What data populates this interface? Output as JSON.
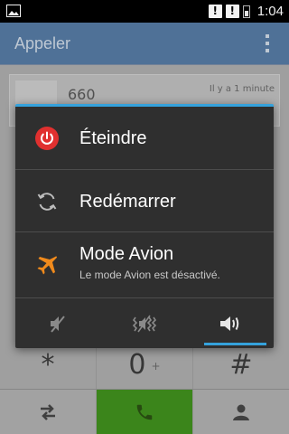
{
  "status_bar": {
    "time": "1:04",
    "alert_1": "!",
    "alert_2": "!",
    "left_icon": "image-icon"
  },
  "action_bar": {
    "title": "Appeler",
    "overflow_icon": "overflow-menu-icon"
  },
  "call_log": {
    "number": "660",
    "time_ago": "Il y a 1 minute"
  },
  "keypad": {
    "star": "*",
    "zero": "0",
    "plus": "+",
    "hash": "#"
  },
  "bottom_bar": {
    "swap_icon": "swap-arrows-icon",
    "call_icon": "phone-icon",
    "contact_icon": "contact-icon"
  },
  "power_dialog": {
    "items": [
      {
        "label": "Éteindre",
        "icon": "power-icon"
      },
      {
        "label": "Redémarrer",
        "icon": "restart-icon"
      },
      {
        "label": "Mode Avion",
        "sub": "Le mode Avion est désactivé.",
        "icon": "airplane-icon"
      }
    ],
    "sound_modes": [
      {
        "icon": "silent-mode-icon",
        "selected": false
      },
      {
        "icon": "vibrate-mode-icon",
        "selected": false
      },
      {
        "icon": "sound-on-icon",
        "selected": true
      }
    ]
  },
  "colors": {
    "accent": "#35a2dc",
    "power_red": "#e0302f",
    "airplane_orange": "#f08a1c",
    "call_green": "#3f8d1d",
    "action_bar": "#5478a0"
  }
}
